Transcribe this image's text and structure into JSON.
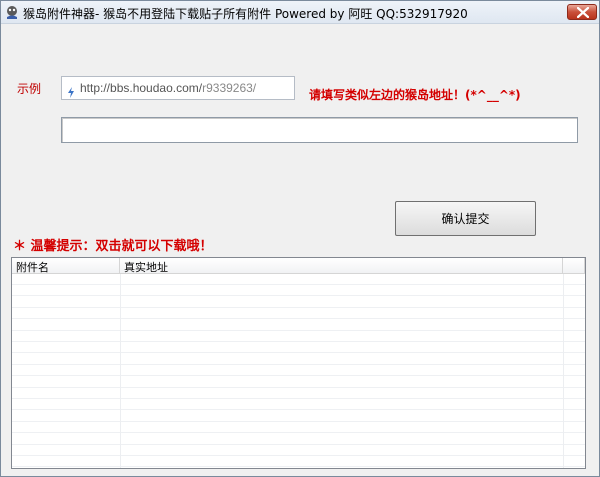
{
  "window": {
    "title": "猴岛附件神器- 猴岛不用登陆下载贴子所有附件 Powered by 阿旺 QQ:532917920"
  },
  "example": {
    "label": "示例",
    "url_main": "http://bbs.houdao.com/",
    "url_dim": "r9339263/"
  },
  "hint": "请填写类似左边的猴岛地址！(*^__^*)",
  "url_input": {
    "value": "",
    "placeholder": ""
  },
  "submit_label": "确认提交",
  "tip": "＊ 温馨提示：双击就可以下载哦！",
  "table": {
    "columns": [
      "附件名",
      "真实地址",
      ""
    ],
    "rows": []
  },
  "colors": {
    "accent_red": "#d40000",
    "close_red": "#c9503a"
  },
  "icons": {
    "app": "houdao-app-icon",
    "url_prefix": "lightning-bolt-icon",
    "close": "close-icon"
  }
}
